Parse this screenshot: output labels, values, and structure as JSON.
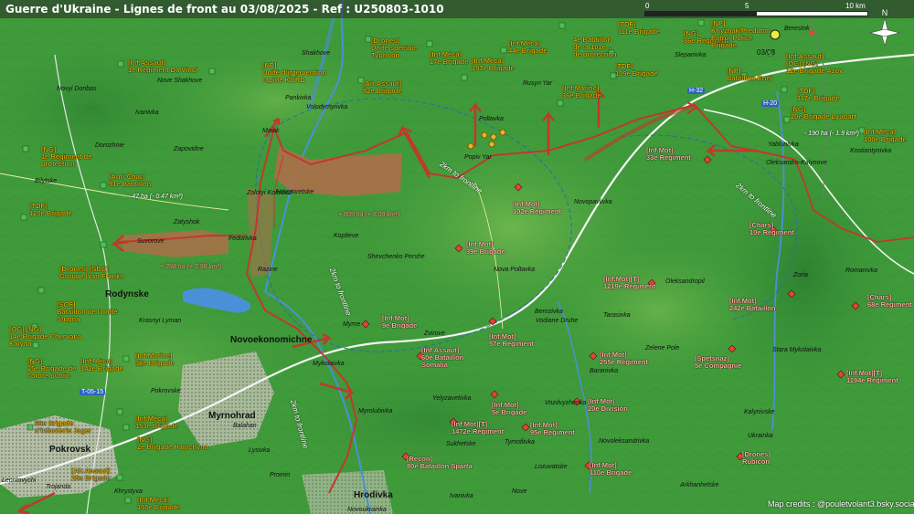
{
  "title": "Guerre d'Ukraine - Lignes de front au 03/08/2025 - Ref : U250803-1010",
  "scale": {
    "zero": "0",
    "mid": "5",
    "end": "10 km",
    "date": "03/08"
  },
  "north_label": "N",
  "credits": "Map credits : @pouletvolant3.bsky.social",
  "colors": {
    "front": "#c0392b",
    "water": "#4a90d9",
    "terrain": "#3f9a3a",
    "unit_text": "#d4a80a"
  },
  "roads": [
    {
      "id": "h32",
      "label": "H-32"
    },
    {
      "id": "h20",
      "label": "H-20"
    },
    {
      "id": "t0515",
      "label": "T-05-15"
    }
  ],
  "areas": [
    {
      "id": "a1",
      "text": "- 47 ha (- 0.47 km²)",
      "red": false
    },
    {
      "id": "a2",
      "text": "+ 809 ha (+ 8.09 km²)",
      "red": true
    },
    {
      "id": "a3",
      "text": "+ 398 ha (+ 3.98 km²)",
      "red": true
    },
    {
      "id": "a4",
      "text": "- 190 ha (- 1.9 km²)",
      "red": false
    }
  ],
  "frontline_labels": [
    {
      "id": "f1",
      "text": "2km to frontline"
    },
    {
      "id": "f2",
      "text": "2km to frontline"
    },
    {
      "id": "f3",
      "text": "2km to frontline"
    },
    {
      "id": "f4",
      "text": "2km to frontline"
    }
  ],
  "places": [
    {
      "id": "p1",
      "text": "Shakhove",
      "big": false
    },
    {
      "id": "p2",
      "text": "Novyi Donbas",
      "big": false
    },
    {
      "id": "p3",
      "text": "Nove Shakhove",
      "big": false
    },
    {
      "id": "p4",
      "text": "Ivanivka",
      "big": false
    },
    {
      "id": "p5",
      "text": "Dorozhnie",
      "big": false
    },
    {
      "id": "p6",
      "text": "Zapovidne",
      "big": false
    },
    {
      "id": "p7",
      "text": "Maiak",
      "big": false
    },
    {
      "id": "p8",
      "text": "Poltavka",
      "big": false
    },
    {
      "id": "p9",
      "text": "Popiv Yar",
      "big": false
    },
    {
      "id": "p10",
      "text": "Rusyn Yar",
      "big": false
    },
    {
      "id": "p11",
      "text": "Volodymyrivka",
      "big": false
    },
    {
      "id": "p12",
      "text": "Pankivka",
      "big": false
    },
    {
      "id": "p13",
      "text": "Bilytske",
      "big": false
    },
    {
      "id": "p14",
      "text": "Zolotyi Kolodiaz",
      "big": false
    },
    {
      "id": "p15",
      "text": "Novotoretske",
      "big": false
    },
    {
      "id": "p16",
      "text": "Zatyshok",
      "big": false
    },
    {
      "id": "p17",
      "text": "Suvorove",
      "big": false
    },
    {
      "id": "p18",
      "text": "Fedorivka",
      "big": false
    },
    {
      "id": "p19",
      "text": "Koptieve",
      "big": false
    },
    {
      "id": "p20",
      "text": "Shevchenko Pershe",
      "big": false
    },
    {
      "id": "p21",
      "text": "Nova Poltavka",
      "big": false
    },
    {
      "id": "p22",
      "text": "Razine",
      "big": false
    },
    {
      "id": "p23",
      "text": "Rodynske",
      "big": true
    },
    {
      "id": "p24",
      "text": "Krasnyi Lyman",
      "big": false
    },
    {
      "id": "p25",
      "text": "Novoekonomichne",
      "big": true
    },
    {
      "id": "p26",
      "text": "Myrne",
      "big": false
    },
    {
      "id": "p27",
      "text": "Zvirove",
      "big": false
    },
    {
      "id": "p28",
      "text": "Mykolaivka",
      "big": false
    },
    {
      "id": "p29",
      "text": "Myrnohrad",
      "big": true
    },
    {
      "id": "p30",
      "text": "Pokrovsk",
      "big": true
    },
    {
      "id": "p31",
      "text": "Hrodivka",
      "big": true
    },
    {
      "id": "p32",
      "text": "Novoukrainka",
      "big": false
    },
    {
      "id": "p33",
      "text": "Promin",
      "big": false
    },
    {
      "id": "p34",
      "text": "Balahan",
      "big": false
    },
    {
      "id": "p35",
      "text": "Lysivka",
      "big": false
    },
    {
      "id": "p36",
      "text": "Myrolubivka",
      "big": false
    },
    {
      "id": "p37",
      "text": "Novopavlivka",
      "big": false
    },
    {
      "id": "p38",
      "text": "Yelyzavetivka",
      "big": false
    },
    {
      "id": "p39",
      "text": "Vozdvyzhenka",
      "big": false
    },
    {
      "id": "p40",
      "text": "Vodiane Druhe",
      "big": false
    },
    {
      "id": "p41",
      "text": "Berezivka",
      "big": false
    },
    {
      "id": "p42",
      "text": "Tarasivka",
      "big": false
    },
    {
      "id": "p43",
      "text": "Baranivka",
      "big": false
    },
    {
      "id": "p44",
      "text": "Zelene Pole",
      "big": false
    },
    {
      "id": "p45",
      "text": "Oleksandropil",
      "big": false
    },
    {
      "id": "p46",
      "text": "Novoleksandrivka",
      "big": false
    },
    {
      "id": "p47",
      "text": "Tymofiivka",
      "big": false
    },
    {
      "id": "p48",
      "text": "Lozuvatske",
      "big": false
    },
    {
      "id": "p49",
      "text": "Yablunivka",
      "big": false
    },
    {
      "id": "p50",
      "text": "Oleksandro-Kalynove",
      "big": false
    },
    {
      "id": "p51",
      "text": "Romanivka",
      "big": false
    },
    {
      "id": "p52",
      "text": "Stara Mykolaivka",
      "big": false
    },
    {
      "id": "p53",
      "text": "Kalynivske",
      "big": false
    },
    {
      "id": "p54",
      "text": "Kostiantynivka",
      "big": false
    },
    {
      "id": "p55",
      "text": "Zoria",
      "big": false
    },
    {
      "id": "p56",
      "text": "Sukhetske",
      "big": false
    },
    {
      "id": "p57",
      "text": "Leontovychi",
      "big": false
    },
    {
      "id": "p58",
      "text": "Trojanda",
      "big": false
    },
    {
      "id": "p59",
      "text": "Ivanivka",
      "big": false
    },
    {
      "id": "p60",
      "text": "Berestok",
      "big": false
    },
    {
      "id": "p61",
      "text": "Slepanivka",
      "big": false
    },
    {
      "id": "p62",
      "text": "Arkhanhelske",
      "big": false
    },
    {
      "id": "p63",
      "text": "Nove",
      "big": false
    },
    {
      "id": "p64",
      "text": "Ukrainka",
      "big": false
    },
    {
      "id": "p65",
      "text": "Khrystyva",
      "big": false
    },
    {
      "id": "p66",
      "text": "Pokrovske",
      "big": false
    }
  ],
  "units": [
    {
      "id": "u1",
      "lines": [
        "[Drones]",
        "Unité spéciale",
        "Typhoon"
      ],
      "ru": false
    },
    {
      "id": "u2",
      "lines": [
        "[Inf.Méca]",
        "17e Brigade"
      ],
      "ru": false
    },
    {
      "id": "u3",
      "lines": [
        "[Inf.Méca]",
        "157e Brigade"
      ],
      "ru": false
    },
    {
      "id": "u4",
      "lines": [
        "[Inf.Méca]",
        "44e Brigade"
      ],
      "ru": false
    },
    {
      "id": "u5",
      "lines": [
        "[TDF]",
        "111e Brigade"
      ],
      "ru": false
    },
    {
      "id": "u6",
      "lines": [
        "4e Bataillon",
        "de la 101e ..",
        "de protection"
      ],
      "ru": false
    },
    {
      "id": "u7",
      "lines": [
        "[NG]",
        "36e Régiment"
      ],
      "ru": false
    },
    {
      "id": "u8",
      "lines": [
        "[NP]",
        "Khyzhak/Predator",
        "Patrol Police",
        "Brigade"
      ],
      "ru": false
    },
    {
      "id": "u9",
      "lines": [
        "[Inf.Assaut]",
        "1e Régiment Da Vinci"
      ],
      "ru": false
    },
    {
      "id": "u10",
      "lines": [
        "[NP]",
        "Unité d'intervention",
        "rapide KORD"
      ],
      "ru": false
    },
    {
      "id": "u11",
      "lines": [
        "[Air.Assaut]",
        "82e Brigade"
      ],
      "ru": false
    },
    {
      "id": "u12",
      "lines": [
        "[TDF]",
        "109e Brigade"
      ],
      "ru": false
    },
    {
      "id": "u13",
      "lines": [
        "[NP]",
        "Bataillon Enei"
      ],
      "ru": false
    },
    {
      "id": "u14",
      "lines": [
        "[Inf.Assaut]",
        "[OG] [NG]",
        "12e Brigade Azov"
      ],
      "ru": false
    },
    {
      "id": "u15",
      "lines": [
        "[Inf.Marine]",
        "36e Brigade"
      ],
      "ru": false
    },
    {
      "id": "u16",
      "lines": [
        "[TDF]",
        "117e Brigade"
      ],
      "ru": false
    },
    {
      "id": "u17",
      "lines": [
        "[NG]",
        "20e Brigade Lyubart"
      ],
      "ru": false
    },
    {
      "id": "u18",
      "lines": [
        "[Inf.Méca]",
        "100e Brigade"
      ],
      "ru": false
    },
    {
      "id": "u19",
      "lines": [
        "[NG]",
        "1e Régiment de",
        "protection"
      ],
      "ru": false
    },
    {
      "id": "u20",
      "lines": [
        "[Anti-Char]",
        "91e Bataillon"
      ],
      "ru": false
    },
    {
      "id": "u21",
      "lines": [
        "[TDF]",
        "120e Brigade"
      ],
      "ru": false
    },
    {
      "id": "u22",
      "lines": [
        "[Drones] [SBU]",
        "Groupe Ivan Franko"
      ],
      "ru": false
    },
    {
      "id": "u23",
      "lines": [
        "[SOF]",
        "Bataillon de l'unité",
        "Stugna"
      ],
      "ru": false
    },
    {
      "id": "u24",
      "lines": [
        "[OG] [NG]",
        "14e Brigade Chervona",
        "Kalyna"
      ],
      "ru": false
    },
    {
      "id": "u25",
      "lines": [
        "[NG]",
        "25e Brigade de",
        "l'ordre public"
      ],
      "ru": false
    },
    {
      "id": "u26",
      "lines": [
        "[Inf.Méca]",
        "142e Brigade"
      ],
      "ru": false
    },
    {
      "id": "u27",
      "lines": [
        "[Inf.Marine]",
        "38e Brigade"
      ],
      "ru": false
    },
    {
      "id": "u28",
      "lines": [
        "[Inf.Méca]",
        "153e Brigade"
      ],
      "ru": false
    },
    {
      "id": "u29",
      "lines": [
        "68e Brigade",
        "d'infanterie Jager"
      ],
      "ru": false
    },
    {
      "id": "u30",
      "lines": [
        "[NG]",
        "2e Brigade Halychyna"
      ],
      "ru": false
    },
    {
      "id": "u31",
      "lines": [
        "[Air.Assaut]",
        "25e Brigade"
      ],
      "ru": false
    },
    {
      "id": "u32",
      "lines": [
        "[Inf.Méca]",
        "155e Brigade"
      ],
      "ru": false
    },
    {
      "id": "u33",
      "lines": [
        "[Inf.Mot]",
        "33e Régiment"
      ],
      "ru": true
    },
    {
      "id": "u34",
      "lines": [
        "[Inf.Mot]",
        "102e Régiment"
      ],
      "ru": true
    },
    {
      "id": "u35",
      "lines": [
        "[Inf.Mot]",
        "39e Brigade"
      ],
      "ru": true
    },
    {
      "id": "u36",
      "lines": [
        "[Chars]",
        "10e Régiment"
      ],
      "ru": true
    },
    {
      "id": "u37",
      "lines": [
        "[Inf.Mot][T]",
        "1219e Régiment"
      ],
      "ru": true
    },
    {
      "id": "u38",
      "lines": [
        "[Inf.Mot]",
        "242e Bataillon"
      ],
      "ru": true
    },
    {
      "id": "u39",
      "lines": [
        "[Chars]",
        "68e Régiment"
      ],
      "ru": true
    },
    {
      "id": "u40",
      "lines": [
        "[Inf.Mot]",
        "9e Brigade"
      ],
      "ru": true
    },
    {
      "id": "u41",
      "lines": [
        "[Inf.Mot]",
        "57e Régiment"
      ],
      "ru": true
    },
    {
      "id": "u42",
      "lines": [
        "[Inf.Assaut]",
        "60e Bataillon",
        "Somalia"
      ],
      "ru": true
    },
    {
      "id": "u43",
      "lines": [
        "[Inf.Mot]",
        "255e Régiment"
      ],
      "ru": true
    },
    {
      "id": "u44",
      "lines": [
        "[Spetsnaz]",
        "5e Compagnie"
      ],
      "ru": true
    },
    {
      "id": "u45",
      "lines": [
        "[Inf.Mot][T]",
        "1194e Régiment"
      ],
      "ru": true
    },
    {
      "id": "u46",
      "lines": [
        "[Inf.Mot]",
        "5e Brigade"
      ],
      "ru": true
    },
    {
      "id": "u47",
      "lines": [
        "[Inf.Mot]",
        "20e Division"
      ],
      "ru": true
    },
    {
      "id": "u48",
      "lines": [
        "[Inf.Mot][T]",
        "1472e Régiment"
      ],
      "ru": true
    },
    {
      "id": "u49",
      "lines": [
        "[Inf.Mot]",
        "95e Régiment"
      ],
      "ru": true
    },
    {
      "id": "u50",
      "lines": [
        "[Recon]",
        "80e Bataillon Sparta"
      ],
      "ru": true
    },
    {
      "id": "u51",
      "lines": [
        "[Inf.Mot]",
        "110e Brigade"
      ],
      "ru": true
    },
    {
      "id": "u52",
      "lines": [
        "[Drones]",
        "Rubicon"
      ],
      "ru": true
    }
  ]
}
